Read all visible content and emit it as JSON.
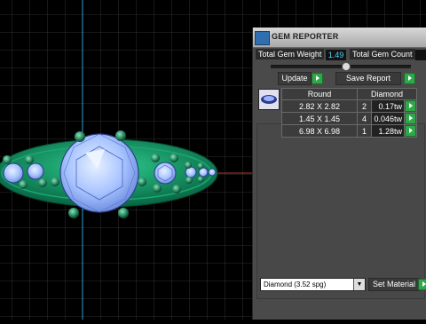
{
  "viewport": {
    "colors": {
      "background": "#000000",
      "grid": "#3a3a3a",
      "axis_v": "#2b9fd6",
      "axis_h": "#c0362c",
      "metal": "#0f8a5a",
      "gem": "#a8c8ff"
    }
  },
  "panel": {
    "title": "GEM REPORTER",
    "total_weight_label": "Total Gem Weight",
    "total_weight_value": "1.49",
    "total_count_label": "Total Gem Count",
    "total_count_value": "",
    "update_label": "Update",
    "save_report_label": "Save Report",
    "table": {
      "headers": [
        "Round",
        "Diamond"
      ],
      "rows": [
        {
          "size": "2.82 X 2.82",
          "count": "2",
          "weight": "0.17tw"
        },
        {
          "size": "1.45 X 1.45",
          "count": "4",
          "weight": "0.046tw"
        },
        {
          "size": "6.98 X 6.98",
          "count": "1",
          "weight": "1.28tw"
        }
      ]
    },
    "material_value": "Diamond (3.52 spg)",
    "set_material_label": "Set Material",
    "icons": {
      "app": "app-icon",
      "go": "play-arrow-icon",
      "dropdown": "chevron-down-icon",
      "thumbnail": "gem-thumbnail-icon"
    }
  }
}
